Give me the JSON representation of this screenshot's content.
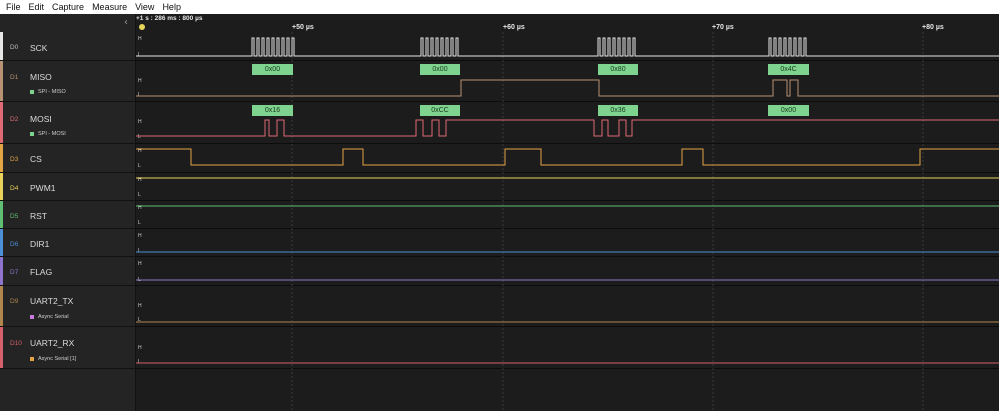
{
  "menu": [
    "File",
    "Edit",
    "Capture",
    "Measure",
    "View",
    "Help"
  ],
  "ruler": {
    "timestamp": "+1 s : 286 ms : 800 µs",
    "ticks": [
      "+50 µs",
      "+60 µs",
      "+70 µs",
      "+80 µs"
    ]
  },
  "level_labels": {
    "high": "H",
    "low": "L"
  },
  "colors": {
    "D0": "#e6e6e6",
    "D1": "#b79273",
    "D2": "#e06a73",
    "D3": "#e3a444",
    "D4": "#e8d25a",
    "D5": "#5fbe72",
    "D6": "#4b8fd6",
    "D7": "#8e74cc",
    "D9": "#b0864e",
    "D10": "#d6606c",
    "spi_label": "#7ed38e",
    "async_label": "#c77be0",
    "async1_label": "#e3a444"
  },
  "channels": [
    {
      "idx": "D0",
      "name": "SCK"
    },
    {
      "idx": "D1",
      "name": "MISO",
      "analyzer": "SPI - MISO"
    },
    {
      "idx": "D2",
      "name": "MOSI",
      "analyzer": "SPI - MOSI"
    },
    {
      "idx": "D3",
      "name": "CS"
    },
    {
      "idx": "D4",
      "name": "PWM1"
    },
    {
      "idx": "D5",
      "name": "RST"
    },
    {
      "idx": "D6",
      "name": "DIR1"
    },
    {
      "idx": "D7",
      "name": "FLAG"
    },
    {
      "idx": "D9",
      "name": "UART2_TX",
      "analyzer": "Async Serial"
    },
    {
      "idx": "D10",
      "name": "UART2_RX",
      "analyzer": "Async Serial [1]"
    }
  ],
  "decodes": {
    "miso": [
      "0x00",
      "0x00",
      "0x80",
      "0x4C"
    ],
    "mosi": [
      "0x16",
      "0xCC",
      "0x36",
      "0x00"
    ]
  }
}
